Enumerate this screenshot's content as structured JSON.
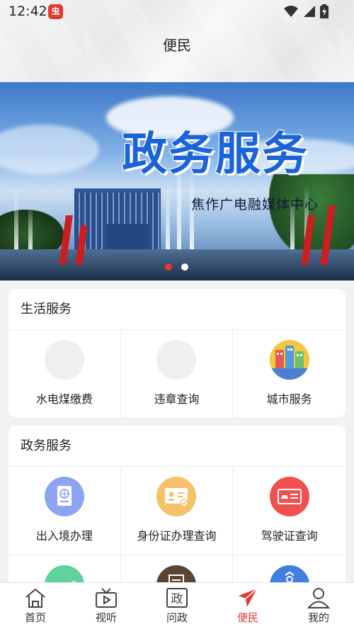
{
  "status_bar": {
    "time": "12:42",
    "app_badge": "虫",
    "icons": [
      "wifi-icon",
      "signal-icon",
      "battery-icon"
    ]
  },
  "header": {
    "title": "便民"
  },
  "banner": {
    "title": "政务服务",
    "subtitle": "焦作广电融媒体中心",
    "slide_count": 2,
    "active_slide": 1
  },
  "sections": [
    {
      "title": "生活服务",
      "items": [
        {
          "label": "水电煤缴费",
          "icon": "placeholder-circle"
        },
        {
          "label": "违章查询",
          "icon": "placeholder-circle"
        },
        {
          "label": "城市服务",
          "icon": "city-icon"
        }
      ]
    },
    {
      "title": "政务服务",
      "items": [
        {
          "label": "出入境办理",
          "icon": "passport-icon"
        },
        {
          "label": "身份证办理查询",
          "icon": "id-card-icon"
        },
        {
          "label": "驾驶证查询",
          "icon": "driver-license-icon"
        },
        {
          "label": "",
          "icon": "airplane-icon"
        },
        {
          "label": "",
          "icon": "document-icon"
        },
        {
          "label": "",
          "icon": "scooter-icon"
        }
      ]
    }
  ],
  "tabbar": {
    "items": [
      {
        "label": "首页",
        "icon": "home-icon"
      },
      {
        "label": "视听",
        "icon": "tv-play-icon"
      },
      {
        "label": "问政",
        "icon": "zheng-icon",
        "glyph": "政"
      },
      {
        "label": "便民",
        "icon": "send-arrow-icon"
      },
      {
        "label": "我的",
        "icon": "user-icon"
      }
    ],
    "active": "便民"
  },
  "colors": {
    "accent": "#e23a2f",
    "passport": "#8da4f0",
    "id_card": "#f5c16a",
    "driver_license": "#f0504e",
    "airplane": "#5fd39a",
    "document": "#5a4535",
    "scooter": "#3f7fe0",
    "placeholder": "#efefef"
  }
}
